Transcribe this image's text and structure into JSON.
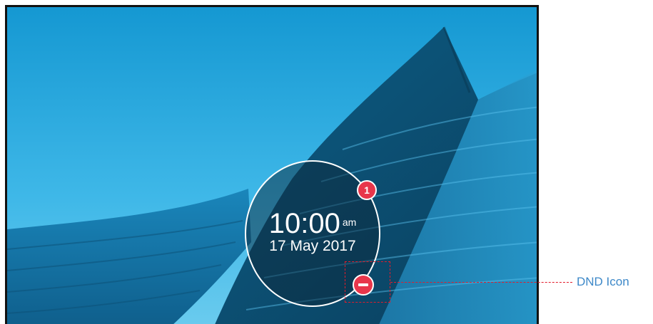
{
  "lockscreen": {
    "time": "10:00",
    "ampm": "am",
    "date": "17 May 2017",
    "notification_count": "1"
  },
  "annotation": {
    "dnd_label": "DND Icon"
  },
  "icons": {
    "badge": "notification-badge-icon",
    "dnd": "do-not-disturb-icon"
  },
  "colors": {
    "sky": "#1fa6dc",
    "badge": "#e8364b",
    "callout_text": "#3d88c8",
    "callout_line": "#e21c2b"
  }
}
